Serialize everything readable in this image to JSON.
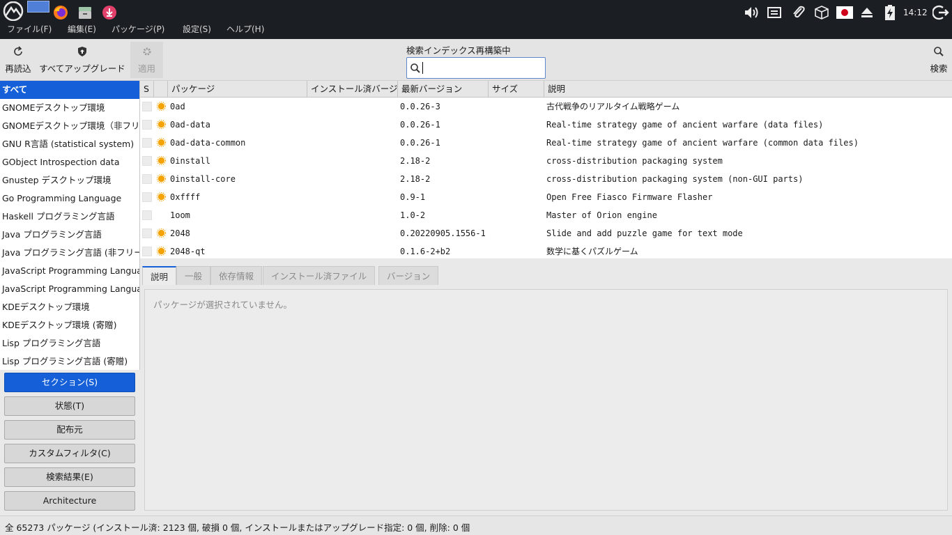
{
  "panel": {
    "clock": "14:12"
  },
  "menubar": [
    "ファイル(F)",
    "編集(E)",
    "パッケージ(P)",
    "設定(S)",
    "ヘルプ(H)"
  ],
  "toolbar": {
    "reload": "再読込",
    "upgrade_all": "すべてアップグレード",
    "apply": "適用",
    "search_label": "検索インデックス再構築中",
    "search_value": "",
    "search": "検索"
  },
  "sidebar": {
    "items": [
      "すべて",
      "GNOMEデスクトップ環境",
      "GNOMEデスクトップ環境（非フリー）",
      "GNU R言語 (statistical system)",
      "GObject Introspection data",
      "Gnustep デスクトップ環境",
      "Go Programming Language",
      "Haskell プログラミング言語",
      "Java プログラミング言語",
      "Java プログラミング言語 (非フリー)",
      "JavaScript Programming Language",
      "JavaScript Programming Language",
      "KDEデスクトップ環境",
      "KDEデスクトップ環境 (寄贈)",
      "Lisp プログラミング言語",
      "Lisp プログラミング言語 (寄贈)"
    ]
  },
  "filters": [
    "セクション(S)",
    "状態(T)",
    "配布元",
    "カスタムフィルタ(C)",
    "検索結果(E)",
    "Architecture"
  ],
  "table": {
    "columns": [
      "S",
      "",
      "パッケージ",
      "インストール済バージョン",
      "最新バージョン",
      "サイズ",
      "説明"
    ],
    "rows": [
      {
        "name": "0ad",
        "latest": "0.0.26-3",
        "desc": "古代戦争のリアルタイム戦略ゲーム",
        "icon": "star-badge-icon"
      },
      {
        "name": "0ad-data",
        "latest": "0.0.26-1",
        "desc": "Real-time strategy game of ancient warfare (data files)",
        "icon": "star-badge-icon"
      },
      {
        "name": "0ad-data-common",
        "latest": "0.0.26-1",
        "desc": "Real-time strategy game of ancient warfare (common data files)",
        "icon": "star-badge-icon"
      },
      {
        "name": "0install",
        "latest": "2.18-2",
        "desc": "cross-distribution packaging system",
        "icon": "star-badge-icon"
      },
      {
        "name": "0install-core",
        "latest": "2.18-2",
        "desc": "cross-distribution packaging system (non-GUI parts)",
        "icon": "star-badge-icon"
      },
      {
        "name": "0xffff",
        "latest": "0.9-1",
        "desc": "Open Free Fiasco Firmware Flasher",
        "icon": "star-badge-icon"
      },
      {
        "name": "1oom",
        "latest": "1.0-2",
        "desc": "Master of Orion engine",
        "icon": ""
      },
      {
        "name": "2048",
        "latest": "0.20220905.1556-1",
        "desc": "Slide and add puzzle game for text mode",
        "icon": "star-badge-icon"
      },
      {
        "name": "2048-qt",
        "latest": "0.1.6-2+b2",
        "desc": "数学に基くパズルゲーム",
        "icon": "star-badge-icon"
      }
    ]
  },
  "tabs": [
    "説明",
    "一般",
    "依存情報",
    "インストール済ファイル",
    "バージョン"
  ],
  "details": {
    "message": "パッケージが選択されていません。"
  },
  "status": "全 65273 パッケージ (インストール済: 2123 個, 破損 0 個, インストールまたはアップグレード指定: 0 個, 削除: 0 個",
  "colors": {
    "accent": "#1560d8",
    "panel": "#1b1f23",
    "badge": "#f5a300"
  }
}
